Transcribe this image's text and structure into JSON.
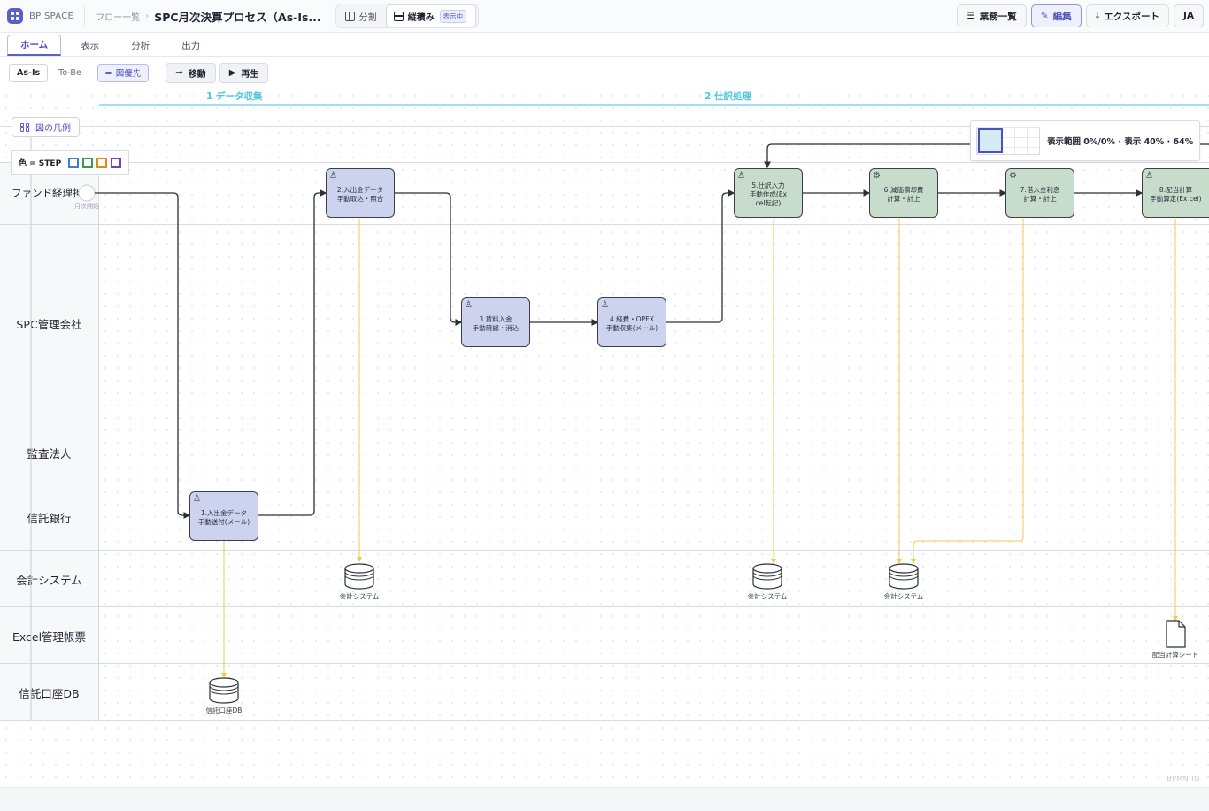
{
  "header": {
    "brand": "BP SPACE",
    "breadcrumb": "フロー一覧",
    "breadcrumb_sep": "›",
    "title": "SPC月次決算プロセス（As-Is...",
    "view_split": "分割",
    "view_stack": "縦積み",
    "view_badge": "表示中",
    "btn_list": "業務一覧",
    "btn_edit": "編集",
    "btn_export": "エクスポート",
    "btn_lang": "JA"
  },
  "tabs": [
    "ホーム",
    "表示",
    "分析",
    "出力"
  ],
  "toolbar": {
    "as_is": "As-Is",
    "to_be": "To-Be",
    "priority": "図優先",
    "move": "移動",
    "play": "再生"
  },
  "phases": [
    "1 データ収集",
    "2 仕訳処理"
  ],
  "legend": {
    "button": "図の凡例",
    "label": "色 = STEP",
    "colors": [
      "#3f7fd1",
      "#3a9a4e",
      "#e08a1e",
      "#7a3fb5"
    ]
  },
  "minimap": {
    "text": "表示範囲 0%/0% · 表示 40% · 64%"
  },
  "lanes": [
    "ファンド経理担当",
    "SPC管理会社",
    "監査法人",
    "信託銀行",
    "会計システム",
    "Excel管理帳票",
    "信託口座DB"
  ],
  "start_label": "月次開始",
  "tasks": [
    {
      "line1": "1.入出金データ",
      "line2": "手動送付(メール)"
    },
    {
      "line1": "2.入出金データ",
      "line2": "手動取込・照合"
    },
    {
      "line1": "3.賃料入金",
      "line2": "手動確認・消込"
    },
    {
      "line1": "4.経費・OPEX",
      "line2": "手動収集(メール)"
    },
    {
      "line1": "5.仕訳入力",
      "line2": "手動作成(Ex",
      "line3": "cel転記)"
    },
    {
      "line1": "6.減価償却費",
      "line2": "計算・計上"
    },
    {
      "line1": "7.借入金利息",
      "line2": "計算・計上"
    },
    {
      "line1": "8.配当計算",
      "line2": "手動算定(Ex cel)"
    }
  ],
  "stores": {
    "db_trust": "信託口座DB",
    "acc1": "会計システム",
    "acc2": "会計システム",
    "acc3": "会計システム",
    "doc_div": "配当計算シート"
  },
  "watermark": "BPMN.IO",
  "colors": {
    "accent": "#5b5fc7",
    "task_blue": "#cdd3ef",
    "task_green": "#c7dccb",
    "data_line": "#f2c94c",
    "phase": "#4ac6df"
  }
}
